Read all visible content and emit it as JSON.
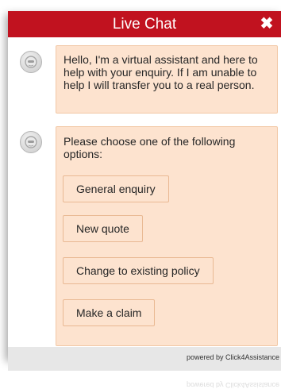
{
  "header": {
    "title": "Live Chat",
    "close_icon": "close-icon"
  },
  "messages": [
    {
      "text": "Hello, I'm a virtual assistant and here to help with your enquiry. If I am unable to help I will transfer you to a real person."
    },
    {
      "text": "Please choose one of the following options:"
    }
  ],
  "options": [
    "General enquiry",
    "New quote",
    "Change to existing policy",
    "Make a claim"
  ],
  "footer": {
    "powered_by": "powered by Click4Assistance"
  },
  "colors": {
    "header": "#c1121f",
    "bubble": "#fde3cf",
    "bubble_border": "#f2c8a6",
    "footer": "#e7e7e7"
  }
}
